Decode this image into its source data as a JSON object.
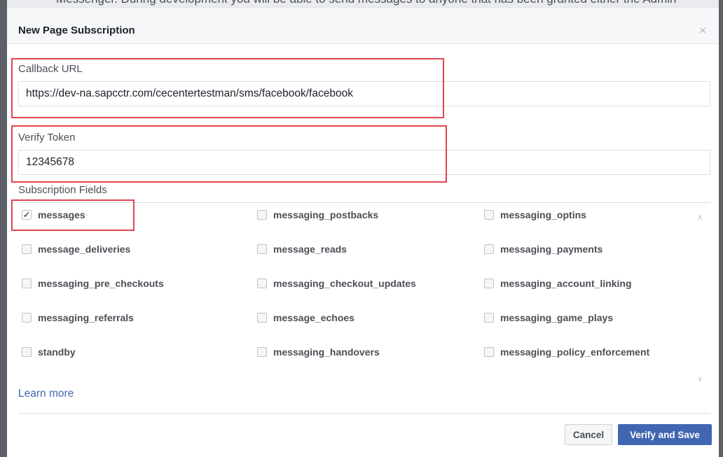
{
  "background_text": "Messenger. During development you will be able to send messages to anyone that has been granted either the Admin",
  "dialog": {
    "title": "New Page Subscription",
    "close_symbol": "×"
  },
  "callback": {
    "label": "Callback URL",
    "value": "https://dev-na.sapcctr.com/cecentertestman/sms/facebook/facebook"
  },
  "verify": {
    "label": "Verify Token",
    "value": "12345678"
  },
  "subscription": {
    "label": "Subscription Fields",
    "fields": [
      {
        "label": "messages",
        "checked": true
      },
      {
        "label": "messaging_postbacks",
        "checked": false
      },
      {
        "label": "messaging_optins",
        "checked": false
      },
      {
        "label": "message_deliveries",
        "checked": false
      },
      {
        "label": "message_reads",
        "checked": false
      },
      {
        "label": "messaging_payments",
        "checked": false
      },
      {
        "label": "messaging_pre_checkouts",
        "checked": false
      },
      {
        "label": "messaging_checkout_updates",
        "checked": false
      },
      {
        "label": "messaging_account_linking",
        "checked": false
      },
      {
        "label": "messaging_referrals",
        "checked": false
      },
      {
        "label": "message_echoes",
        "checked": false
      },
      {
        "label": "messaging_game_plays",
        "checked": false
      },
      {
        "label": "standby",
        "checked": false
      },
      {
        "label": "messaging_handovers",
        "checked": false
      },
      {
        "label": "messaging_policy_enforcement",
        "checked": false
      }
    ]
  },
  "icons": {
    "close": "close-icon",
    "check": "checkmark-icon",
    "scroll_up": "chevron-up-icon",
    "scroll_down": "chevron-down-icon"
  },
  "learn_more": "Learn more",
  "buttons": {
    "cancel": "Cancel",
    "verify": "Verify and Save"
  },
  "colors": {
    "primary": "#4267b2",
    "highlight": "#e0454f",
    "header_bg": "#f6f7f9"
  }
}
